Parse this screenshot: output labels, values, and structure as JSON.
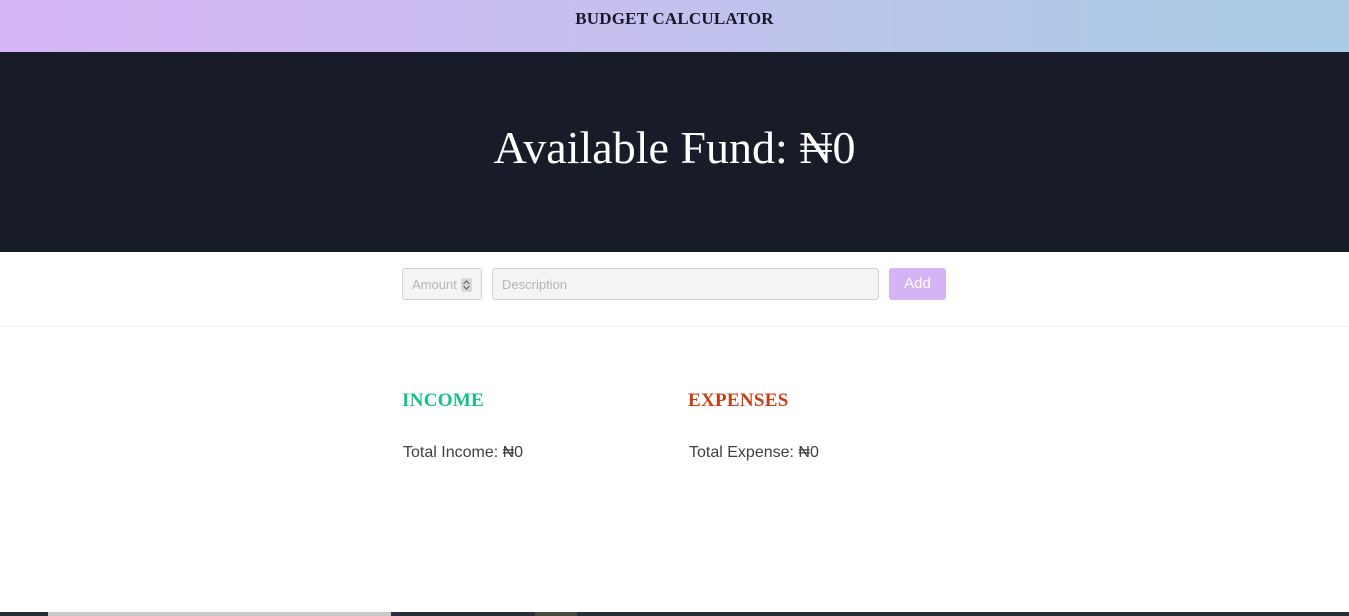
{
  "header": {
    "title": "BUDGET CALCULATOR"
  },
  "hero": {
    "available_fund": "Available Fund: ₦0"
  },
  "form": {
    "amount_placeholder": "Amount",
    "description_placeholder": "Description",
    "add_label": "Add"
  },
  "income": {
    "heading": "INCOME",
    "total": "Total Income: ₦0"
  },
  "expenses": {
    "heading": "EXPENSES",
    "total": "Total Expense: ₦0"
  },
  "colors": {
    "income_accent": "#14c08a",
    "expense_accent": "#cc3c11",
    "add_button": "#d5b3f5",
    "hero_background": "#181c29"
  }
}
